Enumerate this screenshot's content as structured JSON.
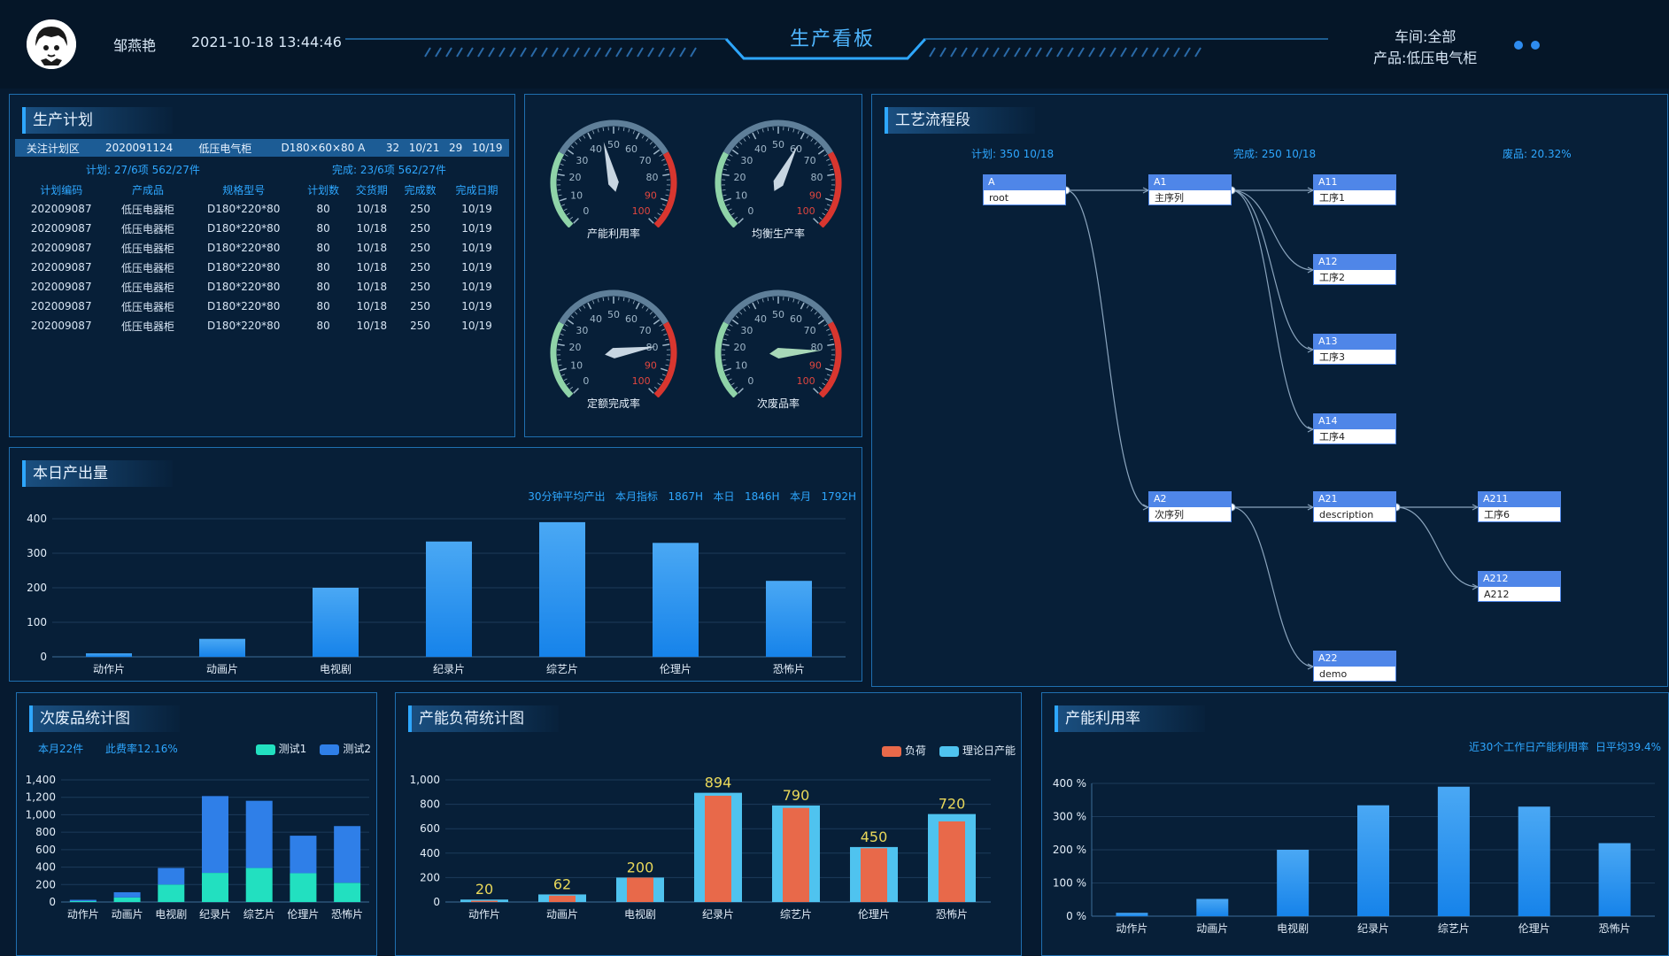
{
  "header": {
    "user": "邹燕艳",
    "datetime": "2021-10-18 13:44:46",
    "title": "生产看板",
    "workshop": "车间:全部",
    "product": "产品:低压电气柜"
  },
  "plan": {
    "title": "生产计划",
    "highlight": [
      "关注计划区",
      "2020091124",
      "低压电气柜",
      "D180×60×80 A",
      "32",
      "10/21",
      "29",
      "10/19"
    ],
    "summary_left": "计划: 27/6项 562/27件",
    "summary_right": "完成: 23/6项 562/27件",
    "columns": [
      "计划编码",
      "产成品",
      "规格型号",
      "计划数",
      "交货期",
      "完成数",
      "完成日期"
    ],
    "rows": [
      [
        "202009087",
        "低压电器柜",
        "D180*220*80",
        "80",
        "10/18",
        "250",
        "10/19"
      ],
      [
        "202009087",
        "低压电器柜",
        "D180*220*80",
        "80",
        "10/18",
        "250",
        "10/19"
      ],
      [
        "202009087",
        "低压电器柜",
        "D180*220*80",
        "80",
        "10/18",
        "250",
        "10/19"
      ],
      [
        "202009087",
        "低压电器柜",
        "D180*220*80",
        "80",
        "10/18",
        "250",
        "10/19"
      ],
      [
        "202009087",
        "低压电器柜",
        "D180*220*80",
        "80",
        "10/18",
        "250",
        "10/19"
      ],
      [
        "202009087",
        "低压电器柜",
        "D180*220*80",
        "80",
        "10/18",
        "250",
        "10/19"
      ],
      [
        "202009087",
        "低压电器柜",
        "D180*220*80",
        "80",
        "10/18",
        "250",
        "10/19"
      ]
    ]
  },
  "gauges": [
    {
      "label": "产能利用率",
      "value": 45
    },
    {
      "label": "均衡生产率",
      "value": 60
    },
    {
      "label": "定额完成率",
      "value": 80
    },
    {
      "label": "次废品率",
      "value": 82
    }
  ],
  "gauge_ticks": [
    "0",
    "10",
    "20",
    "30",
    "40",
    "50",
    "60",
    "70",
    "80",
    "90",
    "100"
  ],
  "output": {
    "title": "本日产出量",
    "stats": [
      "30分钟平均产出",
      "本月指标",
      "1867H",
      "本日",
      "1846H",
      "本月",
      "1792H"
    ]
  },
  "process": {
    "title": "工艺流程段",
    "plan": "计划: 350 10/18",
    "done": "完成: 250 10/18",
    "scrap": "废品: 20.32%",
    "nodes": [
      {
        "id": "A",
        "label": "root"
      },
      {
        "id": "A1",
        "label": "主序列"
      },
      {
        "id": "A11",
        "label": "工序1"
      },
      {
        "id": "A12",
        "label": "工序2"
      },
      {
        "id": "A13",
        "label": "工序3"
      },
      {
        "id": "A14",
        "label": "工序4"
      },
      {
        "id": "A2",
        "label": "次序列"
      },
      {
        "id": "A21",
        "label": "description"
      },
      {
        "id": "A211",
        "label": "工序6"
      },
      {
        "id": "A212",
        "label": "A212"
      },
      {
        "id": "A22",
        "label": "demo"
      }
    ]
  },
  "defect": {
    "title": "次废品统计图",
    "month": "本月22件",
    "rate": "此费率12.16%",
    "legend": [
      "测试1",
      "测试2"
    ]
  },
  "load": {
    "title": "产能负荷统计图",
    "legend": [
      "负荷",
      "理论日产能"
    ]
  },
  "util": {
    "title": "产能利用率",
    "note": "近30个工作日产能利用率",
    "avg": "日平均39.4%"
  },
  "chart_data": [
    {
      "type": "bar",
      "categories": [
        "动作片",
        "动画片",
        "电视剧",
        "纪录片",
        "综艺片",
        "伦理片",
        "恐怖片"
      ],
      "values": [
        10,
        52,
        200,
        334,
        390,
        330,
        220
      ],
      "title": "本日产出量",
      "ylim": [
        0,
        400
      ],
      "yticks": [
        "0",
        "100",
        "200",
        "300",
        "400"
      ]
    },
    {
      "type": "bar",
      "stacked": true,
      "categories": [
        "动作片",
        "动画片",
        "电视剧",
        "纪录片",
        "综艺片",
        "伦理片",
        "恐怖片"
      ],
      "series": [
        {
          "name": "测试1",
          "values": [
            10,
            52,
            200,
            334,
            390,
            330,
            220
          ]
        },
        {
          "name": "测试2",
          "values": [
            15,
            60,
            190,
            880,
            770,
            430,
            650
          ]
        }
      ],
      "title": "次废品统计图",
      "ylim": [
        0,
        1400
      ],
      "yticks": [
        "0",
        "200",
        "400",
        "600",
        "800",
        "1,000",
        "1,200",
        "1,400"
      ]
    },
    {
      "type": "bar",
      "categories": [
        "动作片",
        "动画片",
        "电视剧",
        "纪录片",
        "综艺片",
        "伦理片",
        "恐怖片"
      ],
      "series": [
        {
          "name": "负荷",
          "values": [
            10,
            52,
            200,
            870,
            770,
            440,
            660
          ]
        },
        {
          "name": "理论日产能",
          "values": [
            20,
            62,
            200,
            894,
            790,
            450,
            720
          ]
        }
      ],
      "labels": [
        "20",
        "62",
        "200",
        "894",
        "790",
        "450",
        "720"
      ],
      "title": "产能负荷统计图",
      "ylim": [
        0,
        1000
      ],
      "yticks": [
        "0",
        "200",
        "400",
        "600",
        "800",
        "1,000"
      ]
    },
    {
      "type": "bar",
      "categories": [
        "动作片",
        "动画片",
        "电视剧",
        "纪录片",
        "综艺片",
        "伦理片",
        "恐怖片"
      ],
      "values": [
        10,
        52,
        200,
        334,
        390,
        330,
        220
      ],
      "title": "产能利用率",
      "ylim": [
        0,
        400
      ],
      "yticks": [
        "0 %",
        "100 %",
        "200 %",
        "300 %",
        "400 %"
      ]
    }
  ],
  "colors": {
    "accent": "#2ea7ff",
    "bar": "#1e90f0",
    "stack1": "#22e0c0",
    "stack2": "#2f7fe8",
    "load": "#e8694a",
    "capacity": "#4fc3ef",
    "label": "#e9d85a"
  }
}
